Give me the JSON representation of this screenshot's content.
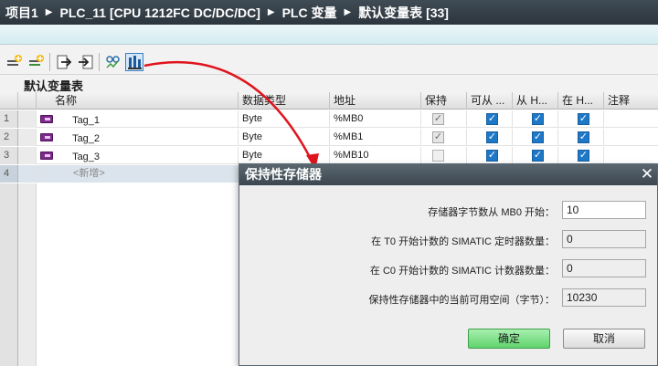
{
  "breadcrumb": {
    "items": [
      "项目1",
      "PLC_11 [CPU 1212FC DC/DC/DC]",
      "PLC 变量",
      "默认变量表 [33]"
    ],
    "separator": "▶"
  },
  "toolbar": {
    "icons": [
      "add-row-icon",
      "insert-row-icon",
      "export-icon",
      "import-icon",
      "monitor-icon",
      "retain-memory-icon"
    ]
  },
  "table": {
    "title": "默认变量表",
    "columns": [
      "名称",
      "数据类型",
      "地址",
      "保持",
      "可从 ...",
      "从 H...",
      "在 H...",
      "注释"
    ],
    "rows": [
      {
        "num": "1",
        "name": "Tag_1",
        "type": "Byte",
        "address": "%MB0",
        "retain": true,
        "accessible": true,
        "writable": true,
        "visible": true
      },
      {
        "num": "2",
        "name": "Tag_2",
        "type": "Byte",
        "address": "%MB1",
        "retain": true,
        "accessible": true,
        "writable": true,
        "visible": true
      },
      {
        "num": "3",
        "name": "Tag_3",
        "type": "Byte",
        "address": "%MB10",
        "retain": false,
        "accessible": true,
        "writable": true,
        "visible": true
      }
    ],
    "new_row": {
      "num": "4",
      "placeholder": "<新增>"
    }
  },
  "dialog": {
    "title": "保持性存储器",
    "fields": [
      {
        "label": "存储器字节数从 MB0 开始：",
        "value": "10",
        "editable": true
      },
      {
        "label": "在 T0 开始计数的 SIMATIC 定时器数量：",
        "value": "0",
        "editable": false
      },
      {
        "label": "在 C0 开始计数的 SIMATIC 计数器数量：",
        "value": "0",
        "editable": false
      },
      {
        "label": "保持性存储器中的当前可用空间（字节）：",
        "value": "10230",
        "editable": false
      }
    ],
    "ok_label": "确定",
    "cancel_label": "取消",
    "close_symbol": "✕"
  },
  "colors": {
    "accent": "#1e78c8",
    "annotation_arrow": "#e0141e",
    "ok_button": "#5fd36c"
  }
}
